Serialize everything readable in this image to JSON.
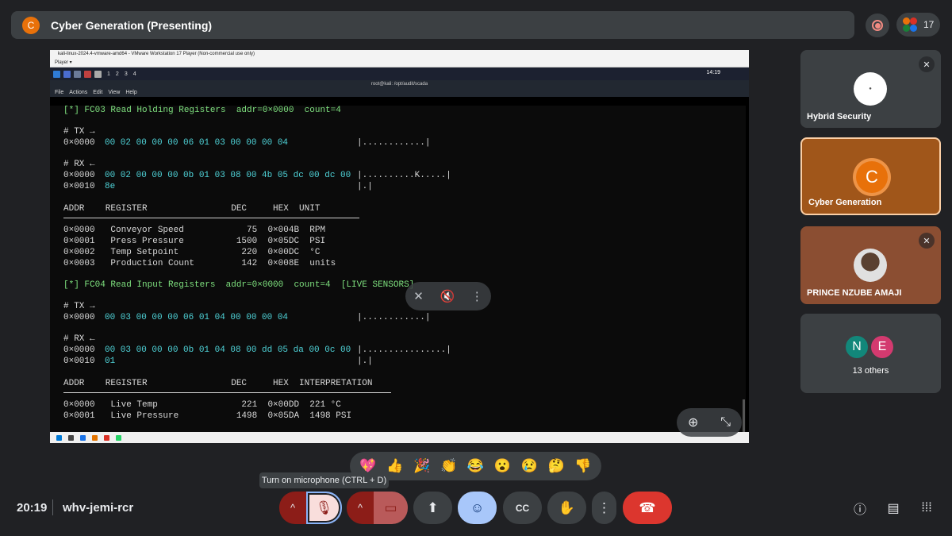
{
  "presenting_bar": {
    "avatar_letter": "C",
    "title": "Cyber Generation (Presenting)",
    "people_count": "17"
  },
  "vm": {
    "window_title": "kali-linux-2024.4-vmware-amd64 - VMware Workstation 17 Player (Non-commercial use only)",
    "player_menu": "Player ▾",
    "workspaces": [
      "1",
      "2",
      "3",
      "4"
    ],
    "clock": "14:19",
    "terminal_title": "root@kali: /opt/audit/scada",
    "menu": [
      "File",
      "Actions",
      "Edit",
      "View",
      "Help"
    ]
  },
  "terminal": {
    "fc03_header": "[*] FC03 Read Holding Registers  addr=0×0000  count=4",
    "tx_label": "# TX →",
    "tx1_offset": "0×0000",
    "tx1_hex": "00 02 00 00 00 06 01 03 00 00 00 04",
    "tx1_ascii": "|............|",
    "rx_label": "# RX ←",
    "rx1_offset": "0×0000",
    "rx1_hex": "00 02 00 00 00 0b 01 03 08 00 4b 05 dc 00 dc 00",
    "rx1_ascii": "|..........K.....|",
    "rx1b_offset": "0×0010",
    "rx1b_hex": "8e",
    "rx1b_ascii": "|.|",
    "table1_header": "ADDR    REGISTER                DEC     HEX  UNIT",
    "table1_rows": [
      "0×0000   Conveyor Speed            75  0×004B  RPM",
      "0×0001   Press Pressure          1500  0×05DC  PSI",
      "0×0002   Temp Setpoint            220  0×00DC  °C",
      "0×0003   Production Count         142  0×008E  units"
    ],
    "fc04_header": "[*] FC04 Read Input Registers  addr=0×0000  count=4  [LIVE SENSORS]",
    "tx2_offset": "0×0000",
    "tx2_hex": "00 03 00 00 00 06 01 04 00 00 00 04",
    "tx2_ascii": "|............|",
    "rx2_offset": "0×0000",
    "rx2_hex": "00 03 00 00 00 0b 01 04 08 00 dd 05 da 00 0c 00",
    "rx2_ascii": "|................|",
    "rx2b_offset": "0×0010",
    "rx2b_hex": "01",
    "rx2b_ascii": "|.|",
    "table2_header": "ADDR    REGISTER                DEC     HEX  INTERPRETATION",
    "table2_rows": [
      "0×0000   Live Temp                221  0×00DD  221 °C",
      "0×0001   Live Pressure           1498  0×05DA  1498 PSI"
    ]
  },
  "participants": [
    {
      "name": "Hybrid Security",
      "muted": true
    },
    {
      "name": "Cyber Generation",
      "avatar_letter": "C",
      "active": true
    },
    {
      "name": "PRINCE NZUBE AMAJI",
      "muted": true
    },
    {
      "name": "13 others",
      "avatars": [
        "N",
        "E"
      ]
    }
  ],
  "reactions": [
    "💖",
    "👍",
    "🎉",
    "👏",
    "😂",
    "😮",
    "😢",
    "🤔",
    "👎"
  ],
  "tooltip": "Turn on microphone (CTRL + D)",
  "bottom": {
    "time": "20:19",
    "meeting_code": "whv-jemi-rcr",
    "cc_label": "CC"
  },
  "colors": {
    "accent_orange": "#e8710a",
    "end_call": "#dc362e",
    "mic_off_bg": "#8c1d18",
    "cyan_text": "#4fd3d8"
  },
  "icons": [
    "record-icon",
    "mic-off-icon",
    "camera-off-icon",
    "present-icon",
    "emoji-icon",
    "captions-icon",
    "raise-hand-icon",
    "more-icon",
    "end-call-icon",
    "info-icon",
    "chat-icon",
    "apps-icon",
    "zoom-in-icon",
    "fullscreen-exit-icon",
    "pin-off-icon",
    "volume-off-icon"
  ]
}
